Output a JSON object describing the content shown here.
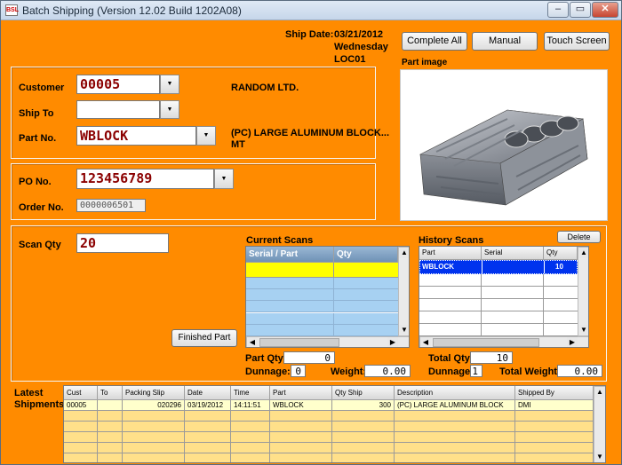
{
  "window": {
    "title": "Batch Shipping (Version 12.02   Build 1202A08)",
    "app_icon_text": "BSL",
    "minimize": "–",
    "maximize": "▭",
    "close": "✕"
  },
  "ship": {
    "date_label": "Ship Date:",
    "date": "03/21/2012",
    "day": "Wednesday",
    "location": "LOC01"
  },
  "toolbar": {
    "complete_all": "Complete All",
    "manual": "Manual",
    "touch_screen": "Touch Screen"
  },
  "part_image": {
    "label": "Part image"
  },
  "customer": {
    "label": "Customer",
    "value": "00005",
    "name": "RANDOM LTD."
  },
  "ship_to": {
    "label": "Ship To",
    "value": ""
  },
  "part_no": {
    "label": "Part No.",
    "value": "WBLOCK",
    "description_line1": "(PC) LARGE ALUMINUM BLOCK...",
    "description_line2": "MT"
  },
  "po": {
    "label": "PO No.",
    "value": "123456789"
  },
  "order": {
    "label": "Order No.",
    "value": "0000006501"
  },
  "scan": {
    "label": "Scan Qty",
    "value": "20",
    "finished_part": "Finished Part"
  },
  "current_scans": {
    "title": "Current Scans",
    "columns": [
      "Serial / Part",
      "Qty"
    ]
  },
  "history_scans": {
    "title": "History Scans",
    "delete": "Delete",
    "columns": [
      "Part",
      "Serial",
      "Qty"
    ],
    "rows": [
      {
        "part": "WBLOCK",
        "serial": "",
        "qty": "10"
      }
    ]
  },
  "totals": {
    "part_qty_label": "Part Qty:",
    "part_qty": "0",
    "dunnage_label": "Dunnage:",
    "dunnage": "0",
    "weight_label": "Weight:",
    "weight": "0.00",
    "total_qty_label": "Total Qty:",
    "total_qty": "10",
    "total_dunnage_label": "Dunnage:",
    "total_dunnage": "1",
    "total_weight_label": "Total Weight:",
    "total_weight": "0.00"
  },
  "latest_shipments": {
    "label_line1": "Latest",
    "label_line2": "Shipments",
    "columns": [
      "Cust",
      "To",
      "Packing Slip",
      "Date",
      "Time",
      "Part",
      "Qty Ship",
      "Description",
      "Shipped By"
    ],
    "rows": [
      {
        "cust": "00005",
        "to": "",
        "packing_slip": "020296",
        "date": "03/19/2012",
        "time": "14:11:51",
        "part": "WBLOCK",
        "qty_ship": "300",
        "description": "(PC) LARGE ALUMINUM BLOCK",
        "shipped_by": "DMI"
      }
    ]
  },
  "colors": {
    "background": "#ff8b00",
    "selection": "#0033ee",
    "current_row": "#ffff00",
    "current_rows": "#a7d1f2",
    "shipments_row": "#ffe08a",
    "shipments_first": "#ffffcc",
    "value_text": "#8b0000"
  }
}
